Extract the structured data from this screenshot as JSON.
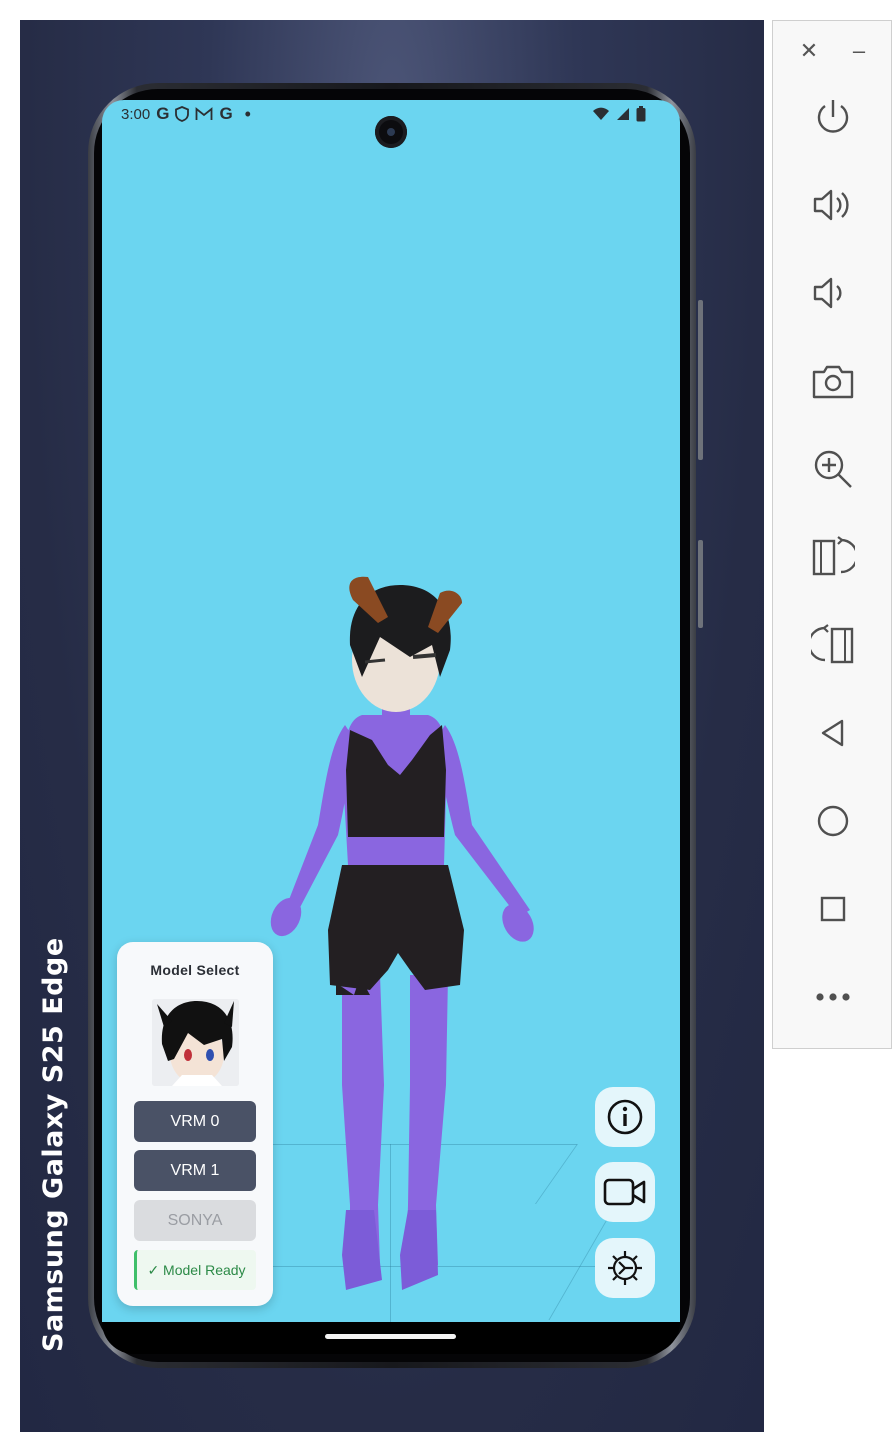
{
  "device": {
    "brand_label": "Samsung Galaxy  S25  Edge"
  },
  "status_bar": {
    "time": "3:00",
    "left_icons": [
      "google-g-icon",
      "shield-icon",
      "gmail-icon",
      "google-g-icon",
      "dot-icon"
    ],
    "right_icons": [
      "wifi-icon",
      "signal-icon",
      "battery-icon"
    ]
  },
  "model_select": {
    "title": "Model Select",
    "buttons": [
      {
        "label": "VRM 0",
        "state": "enabled"
      },
      {
        "label": "VRM 1",
        "state": "enabled"
      },
      {
        "label": "SONYA",
        "state": "disabled"
      }
    ],
    "status": "✓ Model Ready"
  },
  "fab_buttons": [
    "info-icon",
    "video-camera-icon",
    "settings-gear-icon"
  ],
  "emulator_toolbar": {
    "top": [
      "close-icon",
      "minimize-icon"
    ],
    "items": [
      "power-icon",
      "volume-up-icon",
      "volume-down-icon",
      "screenshot-camera-icon",
      "zoom-icon",
      "rotate-right-icon",
      "rotate-left-icon",
      "back-icon",
      "home-icon",
      "overview-icon",
      "more-icon"
    ]
  },
  "colors": {
    "screen_bg": "#6bd5f0",
    "button_dark": "#4a5266",
    "ready_green": "#2c8a47",
    "avatar_body": "#8a6be6"
  }
}
